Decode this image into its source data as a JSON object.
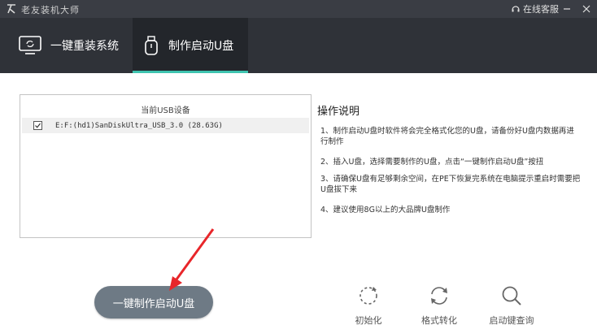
{
  "window": {
    "title": "老友装机大师",
    "support": "在线客服",
    "minimize": "—",
    "close": "✕"
  },
  "tabs": [
    {
      "label": "一键重装系统",
      "icon": "monitor-icon",
      "active": false
    },
    {
      "label": "制作启动U盘",
      "icon": "usb-drive-icon",
      "active": true
    }
  ],
  "device_list": {
    "header": "当前USB设备",
    "rows": [
      {
        "checked": true,
        "text": "E:F:(hd1)SanDiskUltra_USB_3.0 (28.63G)"
      }
    ]
  },
  "instructions": {
    "title": "操作说明",
    "items": [
      "1、制作启动U盘时软件将会完全格式化您的U盘，请备份好U盘内数据再进行制作",
      "2、插入U盘，选择需要制作的U盘，点击“一键制作启动U盘”按扭",
      "3、请确保U盘有足够剩余空间，在PE下恢复完系统在电脑提示重启时需要把U盘拔下来",
      "4、建议使用8G以上的大品牌U盘制作"
    ]
  },
  "main_button": {
    "label": "一键制作启动U盘"
  },
  "tools": [
    {
      "label": "初始化",
      "icon": "refresh-icon"
    },
    {
      "label": "格式转化",
      "icon": "convert-icon"
    },
    {
      "label": "启动键查询",
      "icon": "search-icon"
    }
  ],
  "colors": {
    "titlebar": "#3a3d44",
    "header": "#2f3238",
    "active_tab": "#23262b",
    "accent": "#3fc4b0",
    "button": "#6e7a85",
    "annotation_arrow": "#e8262a"
  }
}
